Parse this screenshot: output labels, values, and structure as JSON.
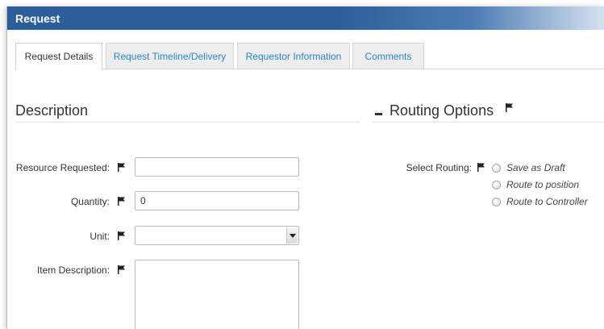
{
  "panel": {
    "title": "Request"
  },
  "tabs": [
    {
      "label": "Request Details",
      "active": true
    },
    {
      "label": "Request Timeline/Delivery",
      "active": false
    },
    {
      "label": "Requestor Information",
      "active": false
    },
    {
      "label": "Comments",
      "active": false
    }
  ],
  "description": {
    "heading": "Description",
    "fields": {
      "resource": {
        "label": "Resource Requested:",
        "value": ""
      },
      "quantity": {
        "label": "Quantity:",
        "value": "0"
      },
      "unit": {
        "label": "Unit:",
        "value": ""
      },
      "item_description": {
        "label": "Item Description:",
        "value": ""
      }
    }
  },
  "routing": {
    "heading": "Routing Options",
    "select_label": "Select Routing:",
    "options": [
      "Save as Draft",
      "Route to position",
      "Route to Controller"
    ]
  },
  "icons": {
    "flag": "flag-icon",
    "collapse": "minus-icon",
    "dropdown": "chevron-down-icon"
  },
  "colors": {
    "header": "#2c5e9c",
    "tab_link": "#2a85c9"
  }
}
